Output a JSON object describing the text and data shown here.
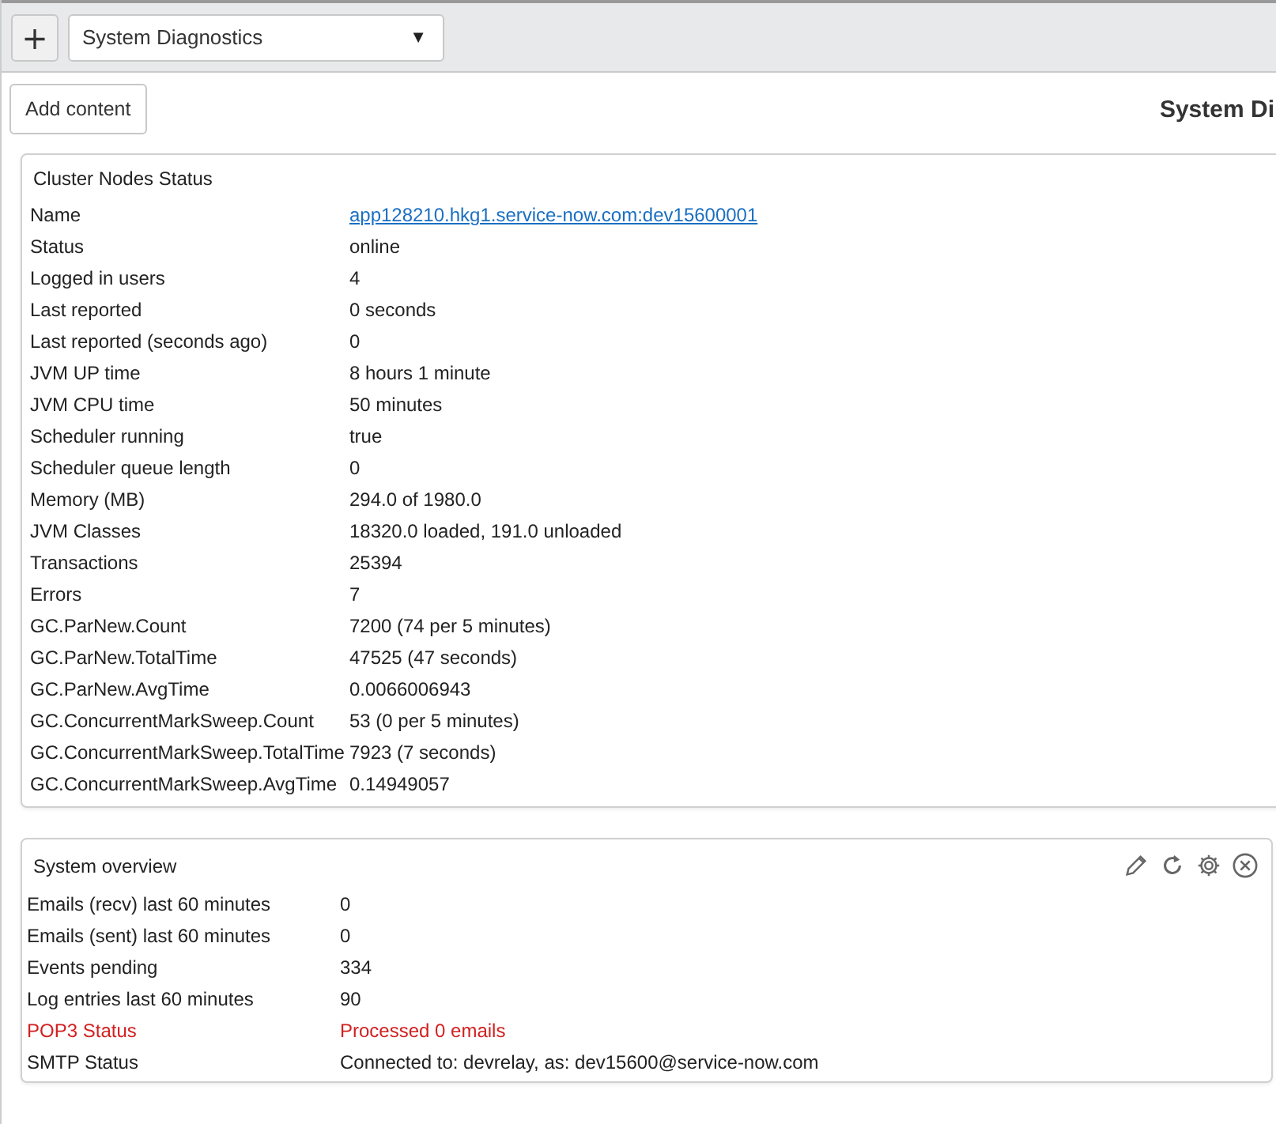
{
  "toolbar": {
    "add_symbol": "+",
    "dashboard_select": {
      "value": "System Diagnostics",
      "caret": "▼"
    }
  },
  "add_content_button": "Add content",
  "page_title": "System Di",
  "cluster_card": {
    "title": "Cluster Nodes Status",
    "rows": [
      {
        "label": "Name",
        "value": "app128210.hkg1.service-now.com:dev15600001",
        "kind": "link"
      },
      {
        "label": "Status",
        "value": "online",
        "kind": "text"
      },
      {
        "label": "Logged in users",
        "value": "4",
        "kind": "text"
      },
      {
        "label": "Last reported",
        "value": "0 seconds",
        "kind": "text"
      },
      {
        "label": "Last reported (seconds ago)",
        "value": "0",
        "kind": "text"
      },
      {
        "label": "JVM UP time",
        "value": "8 hours 1 minute",
        "kind": "text"
      },
      {
        "label": "JVM CPU time",
        "value": "50 minutes",
        "kind": "text"
      },
      {
        "label": "Scheduler running",
        "value": "true",
        "kind": "text"
      },
      {
        "label": "Scheduler queue length",
        "value": "0",
        "kind": "text"
      },
      {
        "label": "Memory (MB)",
        "value": "294.0 of 1980.0",
        "kind": "text"
      },
      {
        "label": "JVM Classes",
        "value": "18320.0 loaded, 191.0 unloaded",
        "kind": "text"
      },
      {
        "label": "Transactions",
        "value": "25394",
        "kind": "text"
      },
      {
        "label": "Errors",
        "value": "7",
        "kind": "text"
      },
      {
        "label": "GC.ParNew.Count",
        "value": "7200 (74 per 5 minutes)",
        "kind": "text"
      },
      {
        "label": "GC.ParNew.TotalTime",
        "value": "47525 (47 seconds)",
        "kind": "text"
      },
      {
        "label": "GC.ParNew.AvgTime",
        "value": "0.0066006943",
        "kind": "text"
      },
      {
        "label": "GC.ConcurrentMarkSweep.Count",
        "value": "53 (0 per 5 minutes)",
        "kind": "text"
      },
      {
        "label": "GC.ConcurrentMarkSweep.TotalTime",
        "value": "7923 (7 seconds)",
        "kind": "text"
      },
      {
        "label": "GC.ConcurrentMarkSweep.AvgTime",
        "value": "0.14949057",
        "kind": "text"
      }
    ]
  },
  "overview_card": {
    "title": "System overview",
    "rows": [
      {
        "label": "Emails (recv) last 60 minutes",
        "value": "0",
        "alert": false
      },
      {
        "label": "Emails (sent) last 60 minutes",
        "value": "0",
        "alert": false
      },
      {
        "label": "Events pending",
        "value": "334",
        "alert": false
      },
      {
        "label": "Log entries last 60 minutes",
        "value": "90",
        "alert": false
      },
      {
        "label": "POP3 Status",
        "value": "Processed 0 emails",
        "alert": true
      },
      {
        "label": "SMTP Status",
        "value": "Connected to: devrelay, as: dev15600@service-now.com",
        "alert": false
      }
    ]
  }
}
